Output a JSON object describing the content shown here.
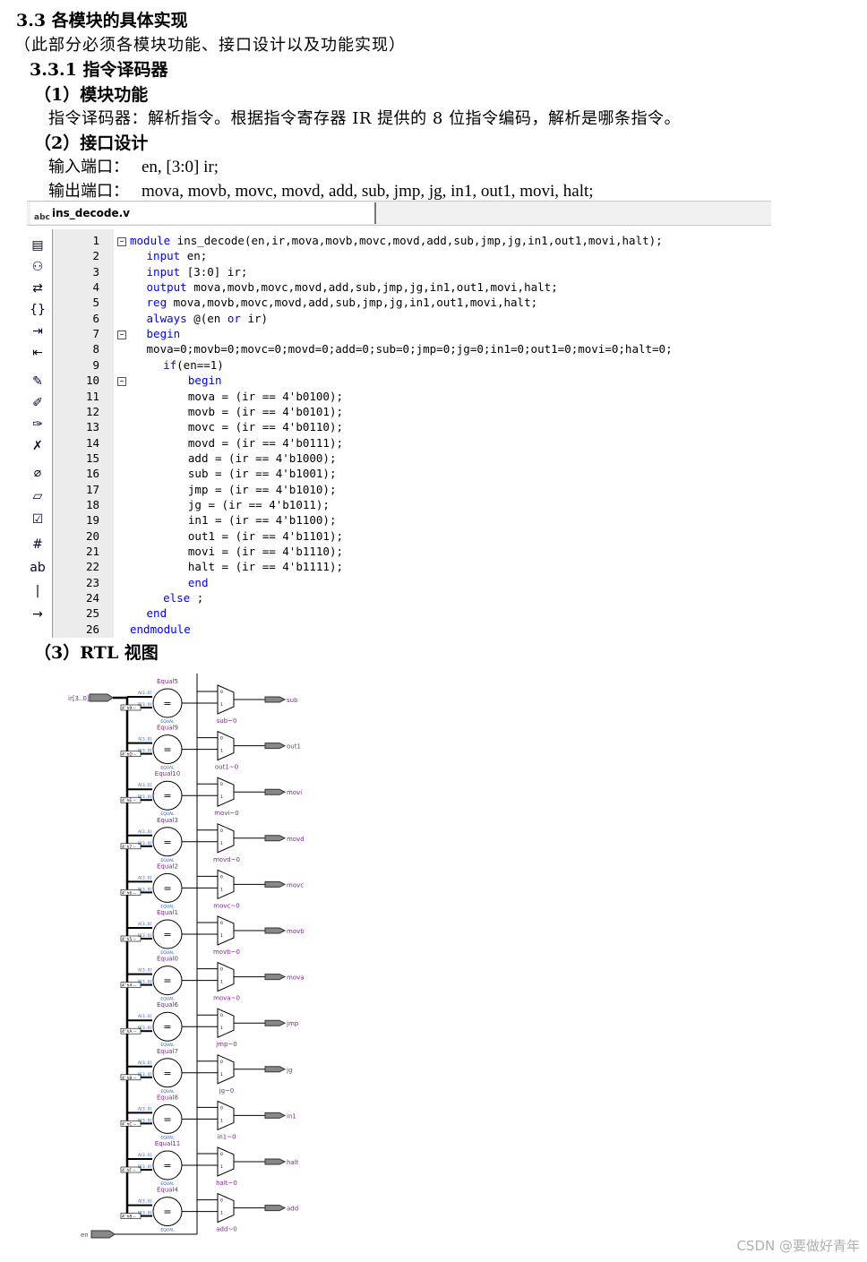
{
  "section_title": "3.3 各模块的具体实现",
  "section_note": "（此部分必须各模块功能、接口设计以及功能实现）",
  "subsection_title": "3.3.1  指令译码器",
  "item1_heading": "（1）模块功能",
  "item1_text": "指令译码器：解析指令。根据指令寄存器 IR 提供的 8 位指令编码，解析是哪条指令。",
  "item2_heading": "（2）接口设计",
  "input_label": "输入端口：",
  "input_ports": "en, [3:0] ir;",
  "output_label": "输出端口：",
  "output_ports": "mova, movb, movc, movd, add, sub, jmp, jg, in1, out1, movi, halt;",
  "editor": {
    "tab_label": "ins_decode.v",
    "tab_icon": "abc-file-icon",
    "toolbar_icons": [
      "file-icon",
      "binoculars-icon",
      "find-replace-icon",
      "braces-icon",
      "indent-icon",
      "outdent-icon",
      "bookmark-icon",
      "bookmark-next-icon",
      "bookmark-prev-icon",
      "bookmark-clear-icon",
      "attach-icon",
      "comment-icon",
      "template-icon",
      "line-number-icon",
      "text-icon",
      "cursor-icon",
      "arrow-icon"
    ],
    "lines": [
      {
        "n": "1",
        "indent": 0,
        "fold": true,
        "text": "module ins_decode(en,ir,mova,movb,movc,movd,add,sub,jmp,jg,in1,out1,movi,halt);",
        "kw": "module"
      },
      {
        "n": "2",
        "indent": 2,
        "fold": false,
        "text": "input en;",
        "kw": "input"
      },
      {
        "n": "3",
        "indent": 2,
        "fold": false,
        "text": "input [3:0] ir;",
        "kw": "input"
      },
      {
        "n": "4",
        "indent": 2,
        "fold": false,
        "text": "output mova,movb,movc,movd,add,sub,jmp,jg,in1,out1,movi,halt;",
        "kw": "output"
      },
      {
        "n": "5",
        "indent": 2,
        "fold": false,
        "text": "reg mova,movb,movc,movd,add,sub,jmp,jg,in1,out1,movi,halt;",
        "kw": "reg"
      },
      {
        "n": "6",
        "indent": 2,
        "fold": false,
        "text": "always @(en or ir)",
        "kw": "always"
      },
      {
        "n": "7",
        "indent": 2,
        "fold": true,
        "text": "begin",
        "kw": "begin"
      },
      {
        "n": "8",
        "indent": 2,
        "fold": false,
        "text": "mova=0;movb=0;movc=0;movd=0;add=0;sub=0;jmp=0;jg=0;in1=0;out1=0;movi=0;halt=0;",
        "kw": ""
      },
      {
        "n": "9",
        "indent": 4,
        "fold": false,
        "text": "if(en==1)",
        "kw": "if"
      },
      {
        "n": "10",
        "indent": 7,
        "fold": true,
        "text": "begin",
        "kw": "begin"
      },
      {
        "n": "11",
        "indent": 7,
        "fold": false,
        "text": "mova = (ir == 4'b0100);",
        "kw": ""
      },
      {
        "n": "12",
        "indent": 7,
        "fold": false,
        "text": "movb = (ir == 4'b0101);",
        "kw": ""
      },
      {
        "n": "13",
        "indent": 7,
        "fold": false,
        "text": "movc = (ir == 4'b0110);",
        "kw": ""
      },
      {
        "n": "14",
        "indent": 7,
        "fold": false,
        "text": "movd = (ir == 4'b0111);",
        "kw": ""
      },
      {
        "n": "15",
        "indent": 7,
        "fold": false,
        "text": "add = (ir == 4'b1000);",
        "kw": ""
      },
      {
        "n": "16",
        "indent": 7,
        "fold": false,
        "text": "sub = (ir == 4'b1001);",
        "kw": ""
      },
      {
        "n": "17",
        "indent": 7,
        "fold": false,
        "text": "jmp = (ir == 4'b1010);",
        "kw": ""
      },
      {
        "n": "18",
        "indent": 7,
        "fold": false,
        "text": "jg = (ir == 4'b1011);",
        "kw": ""
      },
      {
        "n": "19",
        "indent": 7,
        "fold": false,
        "text": "in1 = (ir == 4'b1100);",
        "kw": ""
      },
      {
        "n": "20",
        "indent": 7,
        "fold": false,
        "text": "out1 = (ir == 4'b1101);",
        "kw": ""
      },
      {
        "n": "21",
        "indent": 7,
        "fold": false,
        "text": "movi = (ir == 4'b1110);",
        "kw": ""
      },
      {
        "n": "22",
        "indent": 7,
        "fold": false,
        "text": "halt = (ir == 4'b1111);",
        "kw": ""
      },
      {
        "n": "23",
        "indent": 7,
        "fold": false,
        "text": "end",
        "kw": "end"
      },
      {
        "n": "24",
        "indent": 4,
        "fold": false,
        "text": "else ;",
        "kw": "else"
      },
      {
        "n": "25",
        "indent": 2,
        "fold": false,
        "text": "end",
        "kw": "end"
      },
      {
        "n": "26",
        "indent": 0,
        "fold": false,
        "text": "endmodule",
        "kw": "endmodule"
      }
    ]
  },
  "item3_heading": "（3）RTL 视图",
  "rtl": {
    "input_ir": "ir[3..0]",
    "input_en": "en",
    "comparator_pins": [
      "A[3..0]",
      "B[3..0]"
    ],
    "comparator_type": "EQUAL",
    "comparator_symbol": "=",
    "mux_pins": [
      "0",
      "1"
    ],
    "blocks": [
      {
        "eq": "Equal5",
        "const": "4' h9 --",
        "mux": "sub~0",
        "out": "sub"
      },
      {
        "eq": "Equal9",
        "const": "4' hD --",
        "mux": "out1~0",
        "out": "out1"
      },
      {
        "eq": "Equal10",
        "const": "4' hE --",
        "mux": "movi~0",
        "out": "movi"
      },
      {
        "eq": "Equal3",
        "const": "4' h7 --",
        "mux": "movd~0",
        "out": "movd"
      },
      {
        "eq": "Equal2",
        "const": "4' h6 --",
        "mux": "movc~0",
        "out": "movc"
      },
      {
        "eq": "Equal1",
        "const": "4' h5 --",
        "mux": "movb~0",
        "out": "movb"
      },
      {
        "eq": "Equal0",
        "const": "4' h4 --",
        "mux": "mova~0",
        "out": "mova"
      },
      {
        "eq": "Equal6",
        "const": "4' hA --",
        "mux": "jmp~0",
        "out": "jmp"
      },
      {
        "eq": "Equal7",
        "const": "4' hB --",
        "mux": "jg~0",
        "out": "jg"
      },
      {
        "eq": "Equal8",
        "const": "4' hC --",
        "mux": "in1~0",
        "out": "in1"
      },
      {
        "eq": "Equal11",
        "const": "4' hF --",
        "mux": "halt~0",
        "out": "halt"
      },
      {
        "eq": "Equal4",
        "const": "4' h8 --",
        "mux": "add~0",
        "out": "add"
      }
    ]
  },
  "watermark": "CSDN @要做好青年"
}
